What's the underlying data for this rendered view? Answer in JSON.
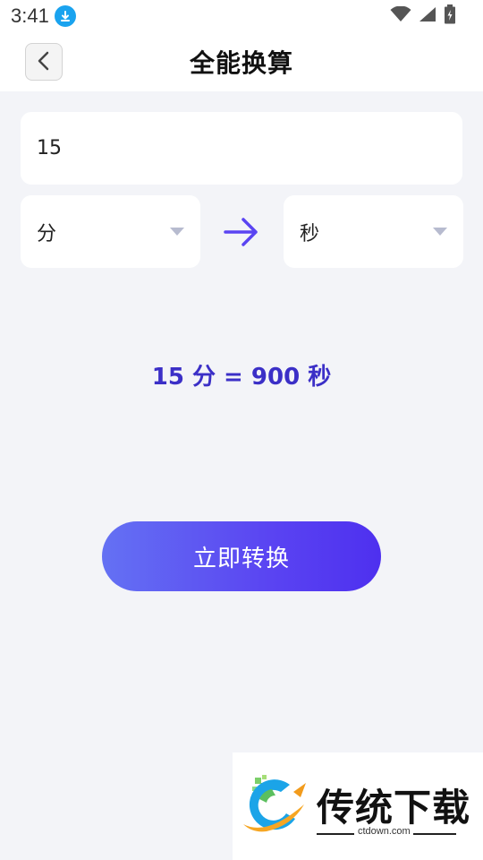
{
  "status_bar": {
    "time": "3:41",
    "icons": [
      "download-icon",
      "wifi-icon",
      "signal-icon",
      "battery-icon"
    ]
  },
  "header": {
    "title": "全能换算",
    "back_icon": "chevron-left-icon"
  },
  "converter": {
    "amount": "15",
    "from_unit": "分",
    "to_unit": "秒",
    "dropdown_icon": "triangle-down-icon",
    "arrow_icon": "arrow-right-icon",
    "result": "15 分 = 900 秒"
  },
  "action": {
    "convert_label": "立即转换"
  },
  "watermark": {
    "text": "传统下载",
    "url": "ctdown.com"
  },
  "colors": {
    "accent": "#5a44f2",
    "result_text": "#3b2fc7",
    "background": "#f3f4f8",
    "status_blue": "#1aa3ef"
  }
}
